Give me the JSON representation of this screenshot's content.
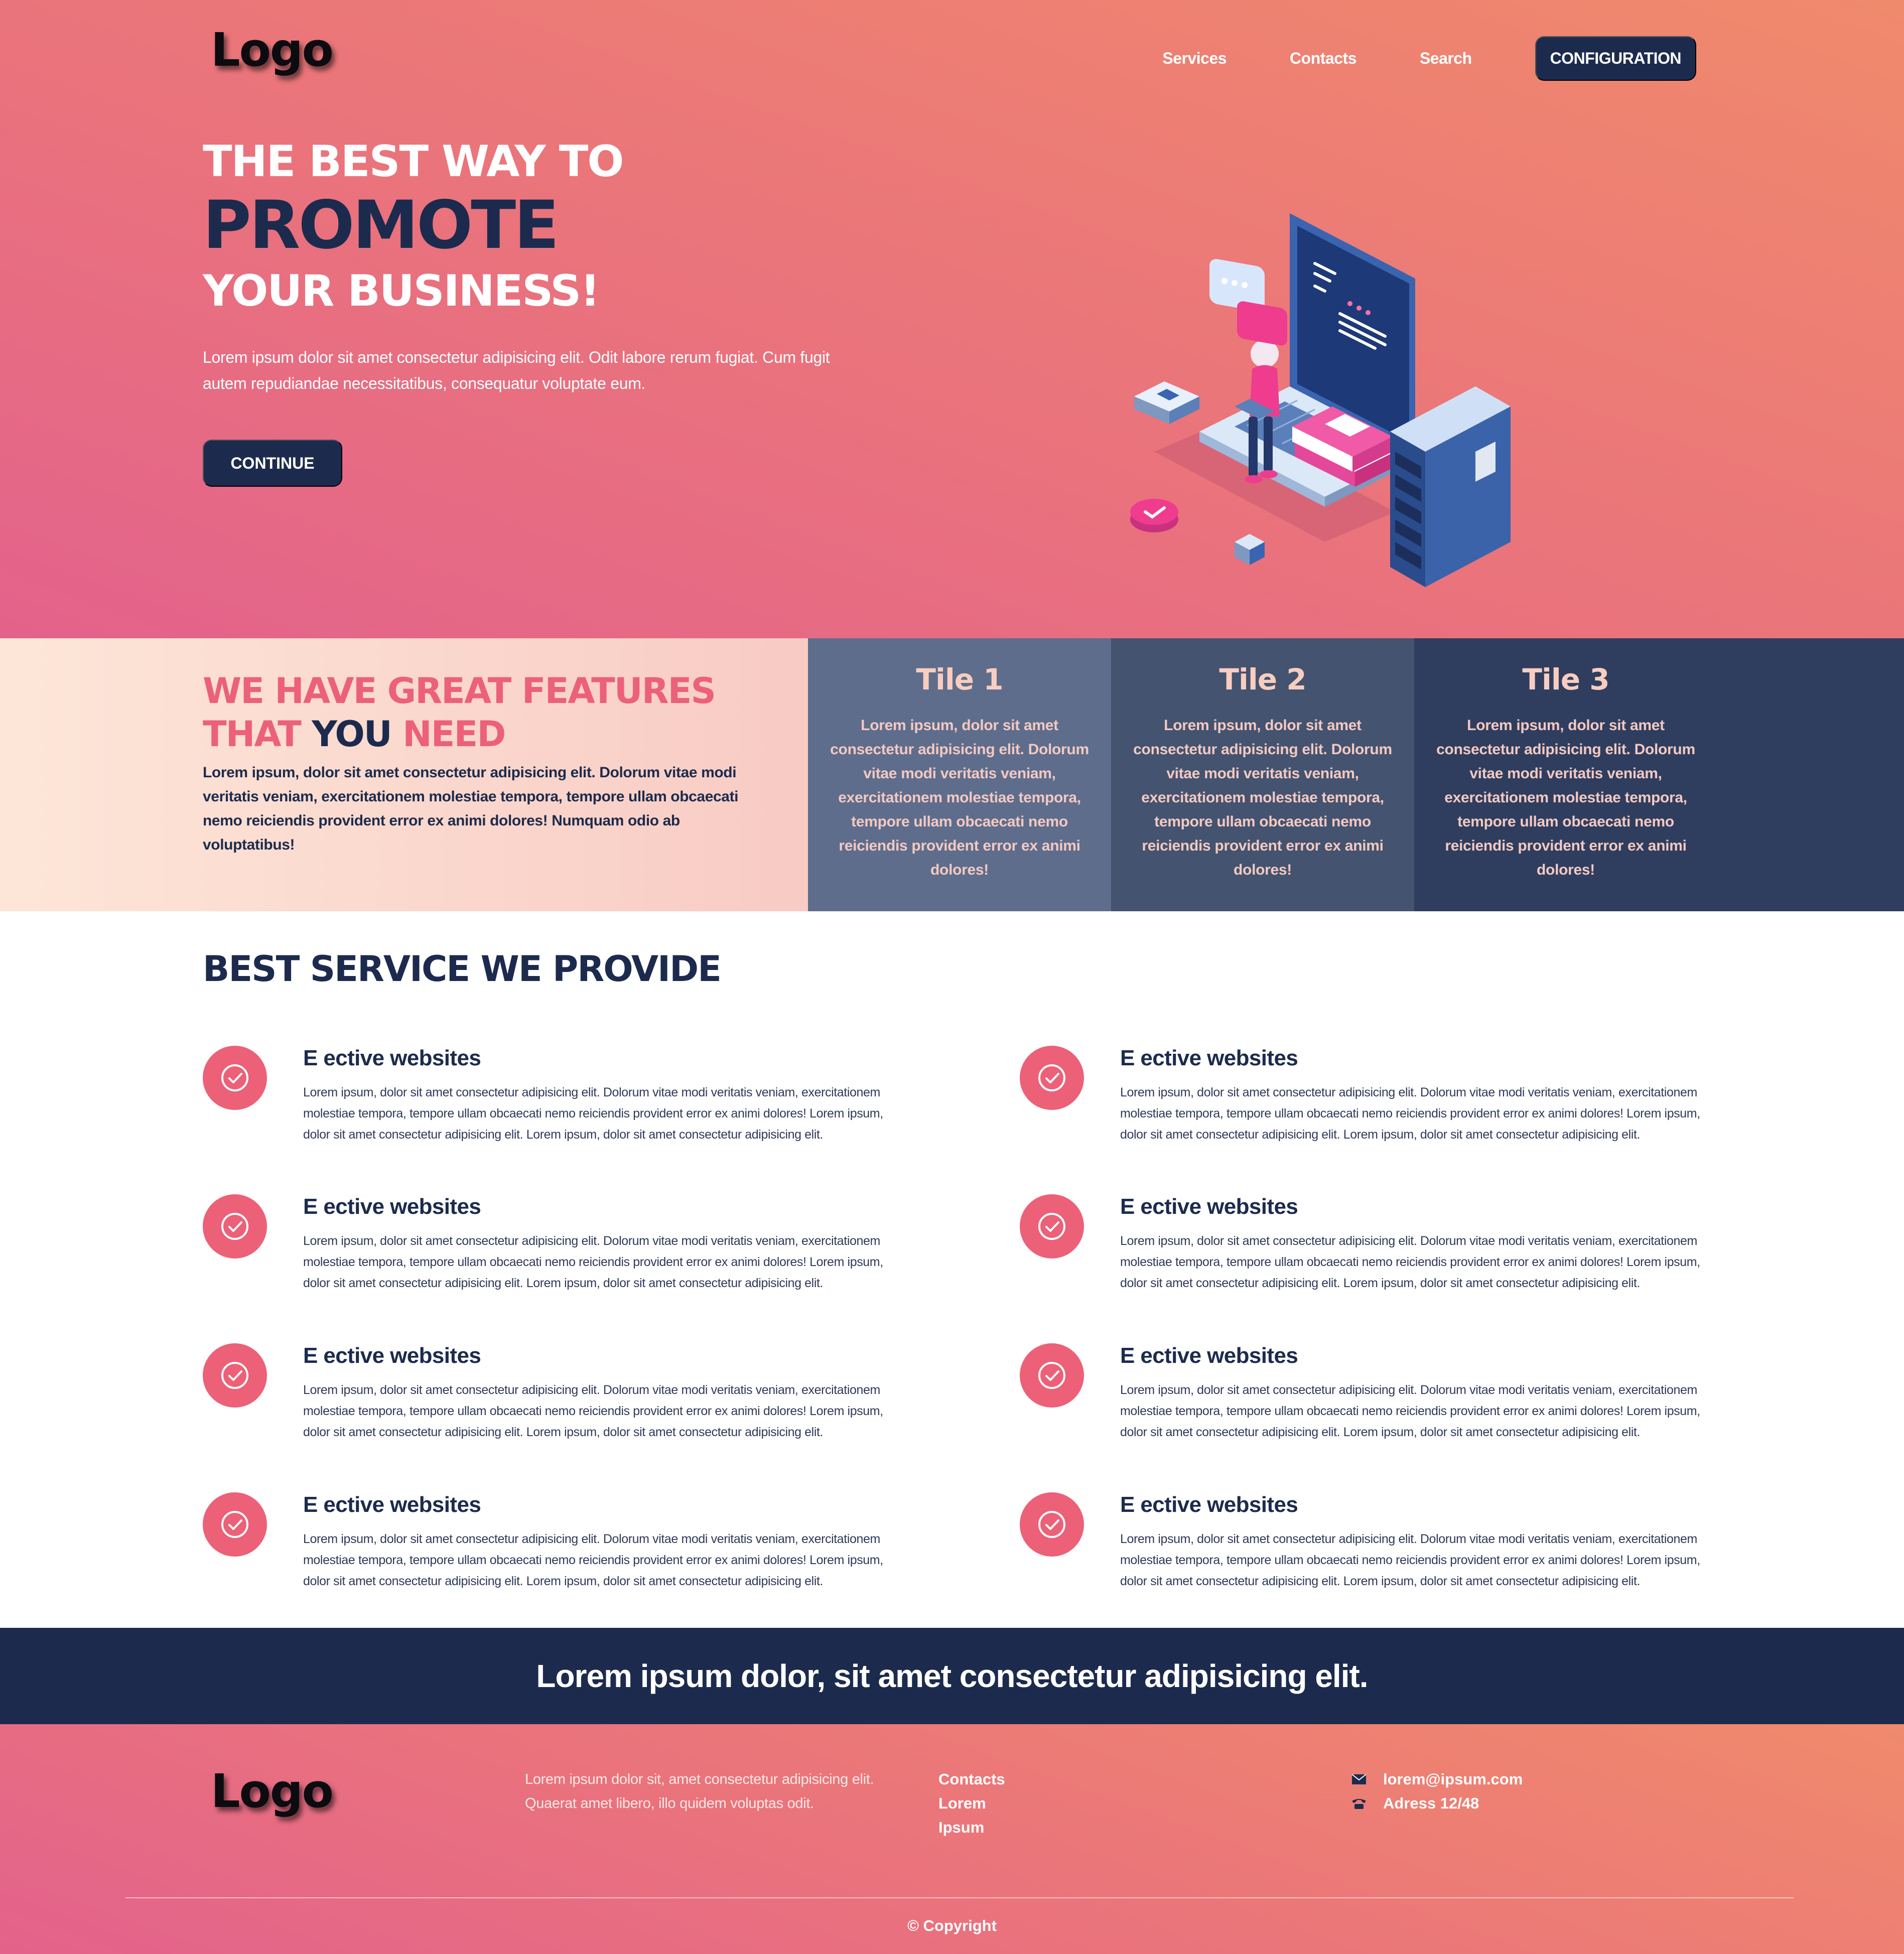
{
  "header": {
    "logo": "Logo",
    "nav": [
      "Services",
      "Contacts",
      "Search"
    ],
    "cta": "CONFIGURATION"
  },
  "hero": {
    "line1": "THE BEST WAY TO",
    "line2": "PROMOTE",
    "line3": "YOUR BUSINESS!",
    "text": "Lorem ipsum dolor sit amet consectetur adipisicing elit. Odit labore rerum fugiat. Cum fugit autem repudiandae necessitatibus, consequatur voluptate eum.",
    "button": "CONTINUE"
  },
  "features": {
    "heading_line1": "WE HAVE GREAT FEATURES",
    "heading_line2_pre": "THAT ",
    "heading_line2_highlight": "YOU",
    "heading_line2_post": " NEED",
    "text": "Lorem ipsum, dolor sit amet consectetur adipisicing elit. Dolorum vitae modi veritatis veniam, exercitationem molestiae tempora, tempore ullam obcaecati nemo reiciendis provident error ex animi dolores! Numquam odio ab voluptatibus!",
    "tiles": [
      {
        "title": "Tile 1",
        "text": "Lorem ipsum, dolor sit amet consectetur adipisicing elit. Dolorum vitae modi veritatis veniam, exercitationem molestiae tempora, tempore ullam obcaecati nemo reiciendis provident error ex animi dolores!",
        "color": "#5f6d8c"
      },
      {
        "title": "Tile 2",
        "text": "Lorem ipsum, dolor sit amet consectetur adipisicing elit. Dolorum vitae modi veritatis veniam, exercitationem molestiae tempora, tempore ullam obcaecati nemo reiciendis provident error ex animi dolores!",
        "color": "#44536f"
      },
      {
        "title": "Tile 3",
        "text": "Lorem ipsum, dolor sit amet consectetur adipisicing elit. Dolorum vitae modi veritatis veniam, exercitationem molestiae tempora, tempore ullam obcaecati nemo reiciendis provident error ex animi dolores!",
        "color": "#2f3e5f"
      }
    ]
  },
  "services": {
    "title": "BEST SERVICE WE PROVIDE",
    "items": [
      {
        "title": "E ective websites",
        "text": "Lorem ipsum, dolor sit amet consectetur adipisicing elit. Dolorum vitae modi veritatis veniam, exercitationem molestiae tempora, tempore ullam obcaecati nemo reiciendis provident error ex animi dolores! Lorem ipsum, dolor sit amet consectetur adipisicing elit. Lorem ipsum, dolor sit amet consectetur adipisicing elit."
      },
      {
        "title": "E ective websites",
        "text": "Lorem ipsum, dolor sit amet consectetur adipisicing elit. Dolorum vitae modi veritatis veniam, exercitationem molestiae tempora, tempore ullam obcaecati nemo reiciendis provident error ex animi dolores! Lorem ipsum, dolor sit amet consectetur adipisicing elit. Lorem ipsum, dolor sit amet consectetur adipisicing elit."
      },
      {
        "title": "E ective websites",
        "text": "Lorem ipsum, dolor sit amet consectetur adipisicing elit. Dolorum vitae modi veritatis veniam, exercitationem molestiae tempora, tempore ullam obcaecati nemo reiciendis provident error ex animi dolores! Lorem ipsum, dolor sit amet consectetur adipisicing elit. Lorem ipsum, dolor sit amet consectetur adipisicing elit."
      },
      {
        "title": "E ective websites",
        "text": "Lorem ipsum, dolor sit amet consectetur adipisicing elit. Dolorum vitae modi veritatis veniam, exercitationem molestiae tempora, tempore ullam obcaecati nemo reiciendis provident error ex animi dolores! Lorem ipsum, dolor sit amet consectetur adipisicing elit. Lorem ipsum, dolor sit amet consectetur adipisicing elit."
      },
      {
        "title": "E ective websites",
        "text": "Lorem ipsum, dolor sit amet consectetur adipisicing elit. Dolorum vitae modi veritatis veniam, exercitationem molestiae tempora, tempore ullam obcaecati nemo reiciendis provident error ex animi dolores! Lorem ipsum, dolor sit amet consectetur adipisicing elit. Lorem ipsum, dolor sit amet consectetur adipisicing elit."
      },
      {
        "title": "E ective websites",
        "text": "Lorem ipsum, dolor sit amet consectetur adipisicing elit. Dolorum vitae modi veritatis veniam, exercitationem molestiae tempora, tempore ullam obcaecati nemo reiciendis provident error ex animi dolores! Lorem ipsum, dolor sit amet consectetur adipisicing elit. Lorem ipsum, dolor sit amet consectetur adipisicing elit."
      },
      {
        "title": "E ective websites",
        "text": "Lorem ipsum, dolor sit amet consectetur adipisicing elit. Dolorum vitae modi veritatis veniam, exercitationem molestiae tempora, tempore ullam obcaecati nemo reiciendis provident error ex animi dolores! Lorem ipsum, dolor sit amet consectetur adipisicing elit. Lorem ipsum, dolor sit amet consectetur adipisicing elit."
      },
      {
        "title": "E ective websites",
        "text": "Lorem ipsum, dolor sit amet consectetur adipisicing elit. Dolorum vitae modi veritatis veniam, exercitationem molestiae tempora, tempore ullam obcaecati nemo reiciendis provident error ex animi dolores! Lorem ipsum, dolor sit amet consectetur adipisicing elit. Lorem ipsum, dolor sit amet consectetur adipisicing elit."
      }
    ]
  },
  "banner": {
    "text": "Lorem ipsum dolor, sit amet consectetur adipisicing elit."
  },
  "footer": {
    "logo": "Logo",
    "text": "Lorem ipsum dolor sit, amet consectetur adipisicing elit. Quaerat amet libero, illo quidem voluptas odit.",
    "links": [
      "Contacts",
      "Lorem",
      "Ipsum"
    ],
    "email": "lorem@ipsum.com",
    "address": "Adress 12/48",
    "email_icon": "envelope-icon",
    "phone_icon": "phone-icon",
    "copyright": "© Copyright"
  },
  "colors": {
    "navy": "#1c2b4d",
    "pink": "#ec6178",
    "coral": "#f08a6c"
  }
}
